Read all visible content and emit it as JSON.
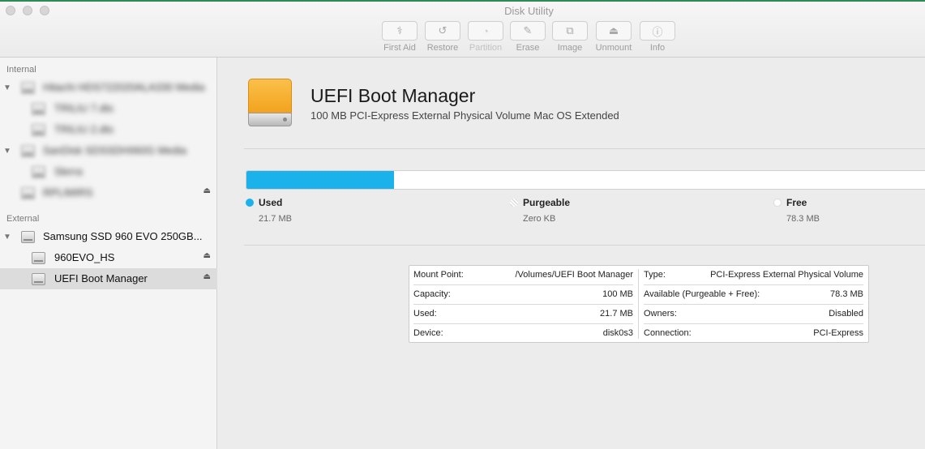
{
  "window": {
    "title": "Disk Utility"
  },
  "toolbar": [
    {
      "label": "First Aid",
      "icon": "stethoscope-icon",
      "glyph": "⚕",
      "enabled": true
    },
    {
      "label": "Restore",
      "icon": "restore-icon",
      "glyph": "↺",
      "enabled": true
    },
    {
      "label": "Partition",
      "icon": "partition-icon",
      "glyph": "◔",
      "enabled": false
    },
    {
      "label": "Erase",
      "icon": "erase-icon",
      "glyph": "✎",
      "enabled": true
    },
    {
      "label": "Image",
      "icon": "image-icon",
      "glyph": "⧉",
      "enabled": true
    },
    {
      "label": "Unmount",
      "icon": "unmount-icon",
      "glyph": "⏏",
      "enabled": true
    },
    {
      "label": "Info",
      "icon": "info-icon",
      "glyph": "ⓘ",
      "enabled": true
    }
  ],
  "sidebar": {
    "internal_header": "Internal",
    "external_header": "External",
    "internal_items": [
      {
        "label": "Hitachi HDS722020ALA330 Media"
      },
      {
        "label": "TRILIU 7.dts"
      },
      {
        "label": "TRILIU 2.dts"
      },
      {
        "label": "SanDisk SDSSDHII60G Media"
      },
      {
        "label": "Slerra"
      },
      {
        "label": "RPLIMIRS"
      }
    ],
    "external_items": [
      {
        "label": "Samsung SSD 960 EVO 250GB..."
      },
      {
        "label": "960EVO_HS"
      },
      {
        "label": "UEFI Boot Manager"
      }
    ]
  },
  "volume": {
    "name": "UEFI Boot Manager",
    "subtitle": "100 MB PCI-Express External Physical Volume Mac OS Extended",
    "usage": {
      "used_fraction": 0.217,
      "legend": [
        {
          "label": "Used",
          "value": "21.7 MB",
          "color": "#1bb1ea"
        },
        {
          "label": "Purgeable",
          "value": "Zero KB",
          "color": "#ffffff"
        },
        {
          "label": "Free",
          "value": "78.3 MB",
          "color": "#ffffff"
        }
      ]
    }
  },
  "info_table": {
    "left": [
      {
        "key": "Mount Point:",
        "value": "/Volumes/UEFI Boot Manager"
      },
      {
        "key": "Capacity:",
        "value": "100 MB"
      },
      {
        "key": "Used:",
        "value": "21.7 MB"
      },
      {
        "key": "Device:",
        "value": "disk0s3"
      }
    ],
    "right": [
      {
        "key": "Type:",
        "value": "PCI-Express External Physical Volume"
      },
      {
        "key": "Available (Purgeable + Free):",
        "value": "78.3 MB"
      },
      {
        "key": "Owners:",
        "value": "Disabled"
      },
      {
        "key": "Connection:",
        "value": "PCI-Express"
      }
    ]
  }
}
